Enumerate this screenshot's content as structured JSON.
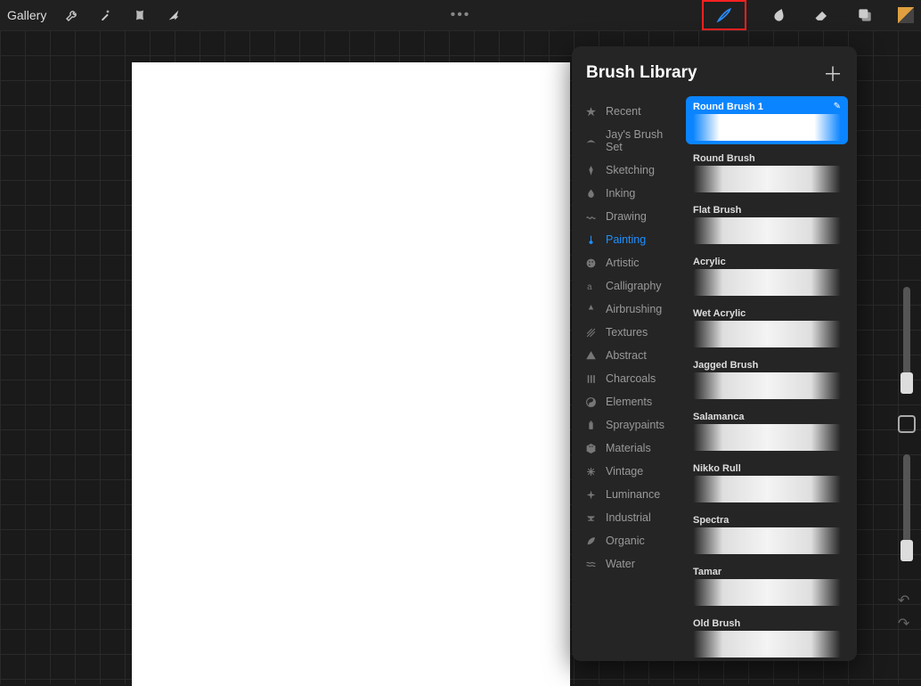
{
  "topbar": {
    "gallery_label": "Gallery",
    "more_label": "•••"
  },
  "panel": {
    "title": "Brush Library"
  },
  "categories": [
    {
      "id": "recent",
      "label": "Recent",
      "icon": "star"
    },
    {
      "id": "jays",
      "label": "Jay's Brush Set",
      "icon": "stroke"
    },
    {
      "id": "sketching",
      "label": "Sketching",
      "icon": "pencil"
    },
    {
      "id": "inking",
      "label": "Inking",
      "icon": "drop"
    },
    {
      "id": "drawing",
      "label": "Drawing",
      "icon": "squiggle"
    },
    {
      "id": "painting",
      "label": "Painting",
      "icon": "brush",
      "active": true
    },
    {
      "id": "artistic",
      "label": "Artistic",
      "icon": "palette"
    },
    {
      "id": "calligraphy",
      "label": "Calligraphy",
      "icon": "script-a"
    },
    {
      "id": "airbrushing",
      "label": "Airbrushing",
      "icon": "spray"
    },
    {
      "id": "textures",
      "label": "Textures",
      "icon": "hatch"
    },
    {
      "id": "abstract",
      "label": "Abstract",
      "icon": "triangle"
    },
    {
      "id": "charcoals",
      "label": "Charcoals",
      "icon": "bars"
    },
    {
      "id": "elements",
      "label": "Elements",
      "icon": "yinyang"
    },
    {
      "id": "spraypaints",
      "label": "Spraypaints",
      "icon": "can"
    },
    {
      "id": "materials",
      "label": "Materials",
      "icon": "cube"
    },
    {
      "id": "vintage",
      "label": "Vintage",
      "icon": "asterisk"
    },
    {
      "id": "luminance",
      "label": "Luminance",
      "icon": "sparkle"
    },
    {
      "id": "industrial",
      "label": "Industrial",
      "icon": "anvil"
    },
    {
      "id": "organic",
      "label": "Organic",
      "icon": "leaf"
    },
    {
      "id": "water",
      "label": "Water",
      "icon": "waves"
    }
  ],
  "brushes": [
    {
      "label": "Round Brush 1",
      "selected": true
    },
    {
      "label": "Round Brush"
    },
    {
      "label": "Flat Brush"
    },
    {
      "label": "Acrylic"
    },
    {
      "label": "Wet Acrylic"
    },
    {
      "label": "Jagged Brush"
    },
    {
      "label": "Salamanca"
    },
    {
      "label": "Nikko Rull"
    },
    {
      "label": "Spectra"
    },
    {
      "label": "Tamar"
    },
    {
      "label": "Old Brush"
    }
  ]
}
